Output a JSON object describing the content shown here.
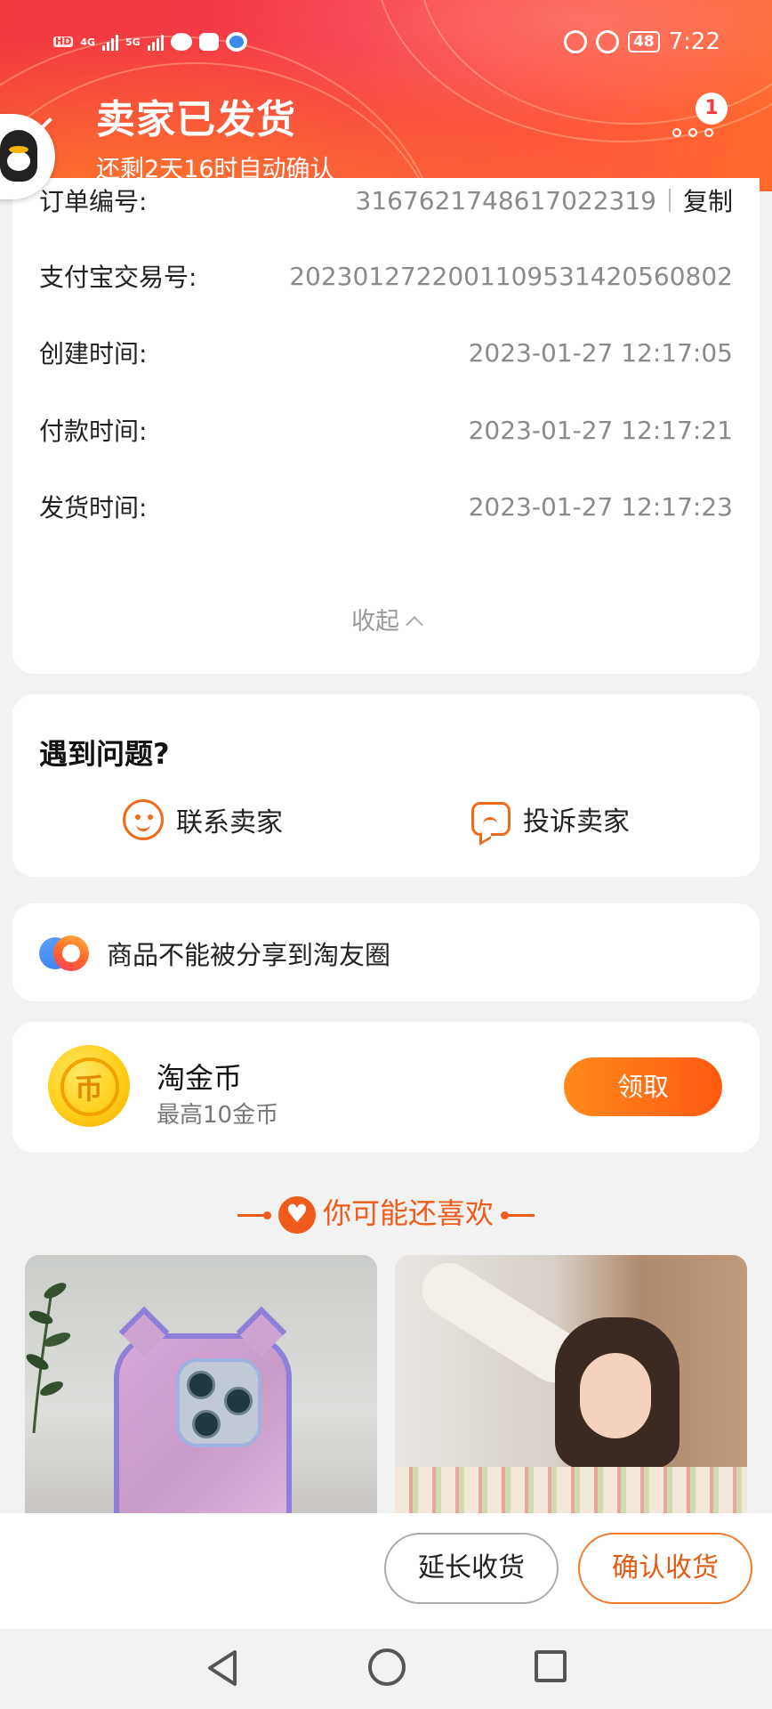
{
  "status_bar": {
    "net1": "4G",
    "net2": "5G",
    "battery": "48",
    "time": "7:22"
  },
  "header": {
    "title": "卖家已发货",
    "subtitle": "还剩2天16时自动确认",
    "badge_count": "1"
  },
  "order_info": {
    "rows": [
      {
        "label": "订单编号:",
        "value": "3167621748617022319",
        "action": "复制"
      },
      {
        "label": "支付宝交易号:",
        "value": "2023012722001109531420560802"
      },
      {
        "label": "创建时间:",
        "value": "2023-01-27 12:17:05"
      },
      {
        "label": "付款时间:",
        "value": "2023-01-27 12:17:21"
      },
      {
        "label": "发货时间:",
        "value": "2023-01-27 12:17:23"
      }
    ],
    "collapse_label": "收起"
  },
  "problem": {
    "title": "遇到问题?",
    "contact_label": "联系卖家",
    "complain_label": "投诉卖家"
  },
  "share": {
    "text": "商品不能被分享到淘友圈"
  },
  "coin": {
    "glyph": "币",
    "title": "淘金币",
    "subtitle": "最高10金币",
    "button": "领取"
  },
  "recommend": {
    "title": "你可能还喜欢"
  },
  "actions": {
    "extend": "延长收货",
    "confirm": "确认收货"
  },
  "colors": {
    "header_red": "#f23a3f",
    "accent_orange": "#f05a1a"
  }
}
